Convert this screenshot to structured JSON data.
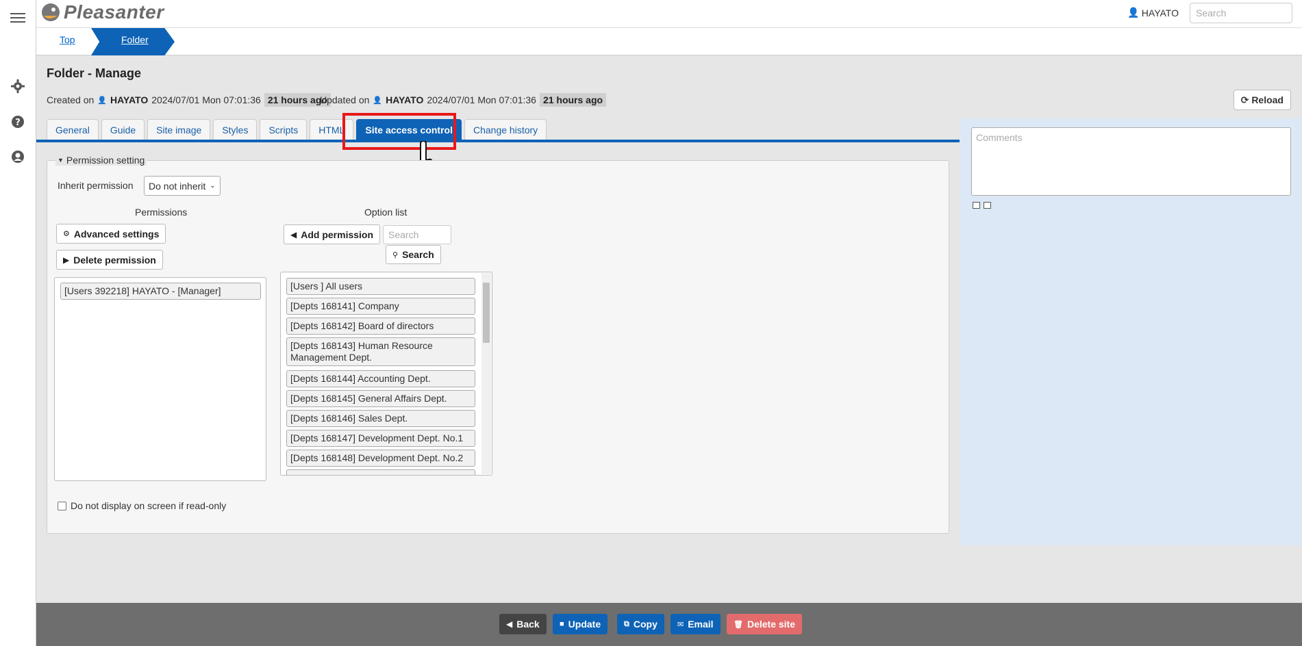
{
  "app": {
    "brand": "Pleasanter"
  },
  "header": {
    "user": "HAYATO",
    "search_placeholder": "Search"
  },
  "breadcrumb": {
    "top": "Top",
    "current": "Folder"
  },
  "page": {
    "title": "Folder - Manage",
    "created_label": "Created on",
    "created_by": "HAYATO",
    "created_at": "2024/07/01 Mon 07:01:36",
    "created_ago": "21 hours ago",
    "updated_label": "Updated on",
    "updated_by": "HAYATO",
    "updated_at": "2024/07/01 Mon 07:01:36",
    "updated_ago": "21 hours ago",
    "reload": "Reload"
  },
  "tabs": [
    {
      "label": "General"
    },
    {
      "label": "Guide"
    },
    {
      "label": "Site image"
    },
    {
      "label": "Styles"
    },
    {
      "label": "Scripts"
    },
    {
      "label": "HTML"
    },
    {
      "label": "Site access control",
      "active": true
    },
    {
      "label": "Change history"
    }
  ],
  "permission": {
    "legend": "Permission setting",
    "inherit_label": "Inherit permission",
    "inherit_value": "Do not inherit",
    "permissions_head": "Permissions",
    "options_head": "Option list",
    "advanced_settings": "Advanced settings",
    "delete_permission": "Delete permission",
    "add_permission": "Add permission",
    "search_placeholder": "Search",
    "search_button": "Search",
    "current": [
      "[Users 392218] HAYATO - [Manager]"
    ],
    "options": [
      "[Users ] All users",
      "[Depts 168141] Company",
      "[Depts 168142] Board of directors",
      "[Depts 168143] Human Resource Management Dept.",
      "[Depts 168144] Accounting Dept.",
      "[Depts 168145] General Affairs Dept.",
      "[Depts 168146] Sales Dept.",
      "[Depts 168147] Development Dept. No.1",
      "[Depts 168148] Development Dept. No.2"
    ],
    "readonly_checkbox": "Do not display on screen if read-only"
  },
  "comments": {
    "placeholder": "Comments"
  },
  "footer": {
    "back": "Back",
    "update": "Update",
    "copy": "Copy",
    "email": "Email",
    "delete": "Delete site"
  },
  "colors": {
    "primary": "#0e63b6",
    "danger": "#e36b6b",
    "highlight": "#e81818",
    "footer_bg": "#6e6e6e",
    "dark_button": "#444444"
  }
}
